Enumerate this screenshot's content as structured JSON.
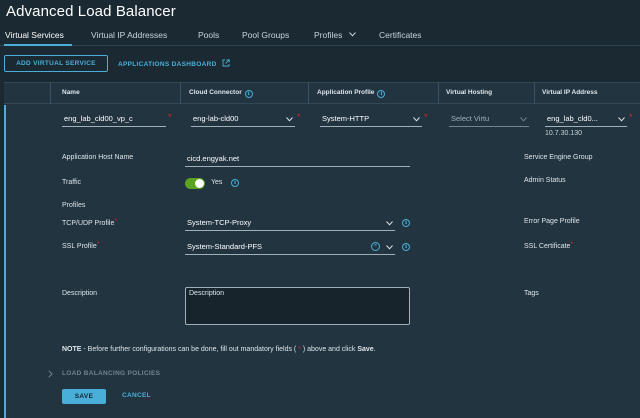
{
  "app": {
    "title": "Advanced Load Balancer"
  },
  "tabs": [
    {
      "label": "Virtual Services",
      "active": true
    },
    {
      "label": "Virtual IP Addresses"
    },
    {
      "label": "Pools"
    },
    {
      "label": "Pool Groups"
    },
    {
      "label": "Profiles"
    },
    {
      "label": "Certificates"
    }
  ],
  "toolbar": {
    "add_label": "ADD VIRTUAL SERVICE",
    "dashboard_label": "APPLICATIONS DASHBOARD"
  },
  "columns": {
    "name": "Name",
    "cloud_connector": "Cloud Connector",
    "application_profile": "Application Profile",
    "virtual_hosting": "Virtual Hosting",
    "virtual_ip": "Virtual IP Address"
  },
  "row": {
    "name": "eng_lab_cld00_vp_c",
    "cloud_connector": "eng-lab-cld00",
    "application_profile": "System-HTTP",
    "virtual_hosting": "Select Virtu",
    "virtual_ip": "eng_lab_cld0...",
    "virtual_ip_address": "10.7.30.130"
  },
  "form": {
    "app_host_label": "Application Host Name",
    "app_host_value": "cicd.engyak.net",
    "traffic_label": "Traffic",
    "traffic_value": "Yes",
    "traffic_on": true,
    "profiles_heading": "Profiles",
    "tcp_label": "TCP/UDP Profile",
    "tcp_value": "System-TCP-Proxy",
    "ssl_label": "SSL Profile",
    "ssl_value": "System-Standard-PFS",
    "description_label": "Description",
    "description_placeholder": "Description",
    "service_engine_label": "Service Engine Group",
    "admin_status_label": "Admin Status",
    "error_page_label": "Error Page Profile",
    "ssl_cert_label": "SSL Certificate",
    "tags_label": "Tags"
  },
  "note": {
    "prefix": "NOTE",
    "text": " - Before further configurations can be done, fill out mandatory fields ( ",
    "asterisk": "*",
    "suffix": " ) above and click ",
    "save_word": "Save",
    "end": "."
  },
  "section": {
    "lb_policies": "LOAD BALANCING POLICIES"
  },
  "actions": {
    "save": "SAVE",
    "cancel": "CANCEL"
  },
  "colors": {
    "accent": "#49afd9",
    "required": "#e02020",
    "toggle_on": "#5aa220",
    "background": "#1b2a32"
  },
  "icons": [
    "info-icon",
    "external-link-icon",
    "chevron-down-icon",
    "chevron-right-icon",
    "clear-icon"
  ]
}
